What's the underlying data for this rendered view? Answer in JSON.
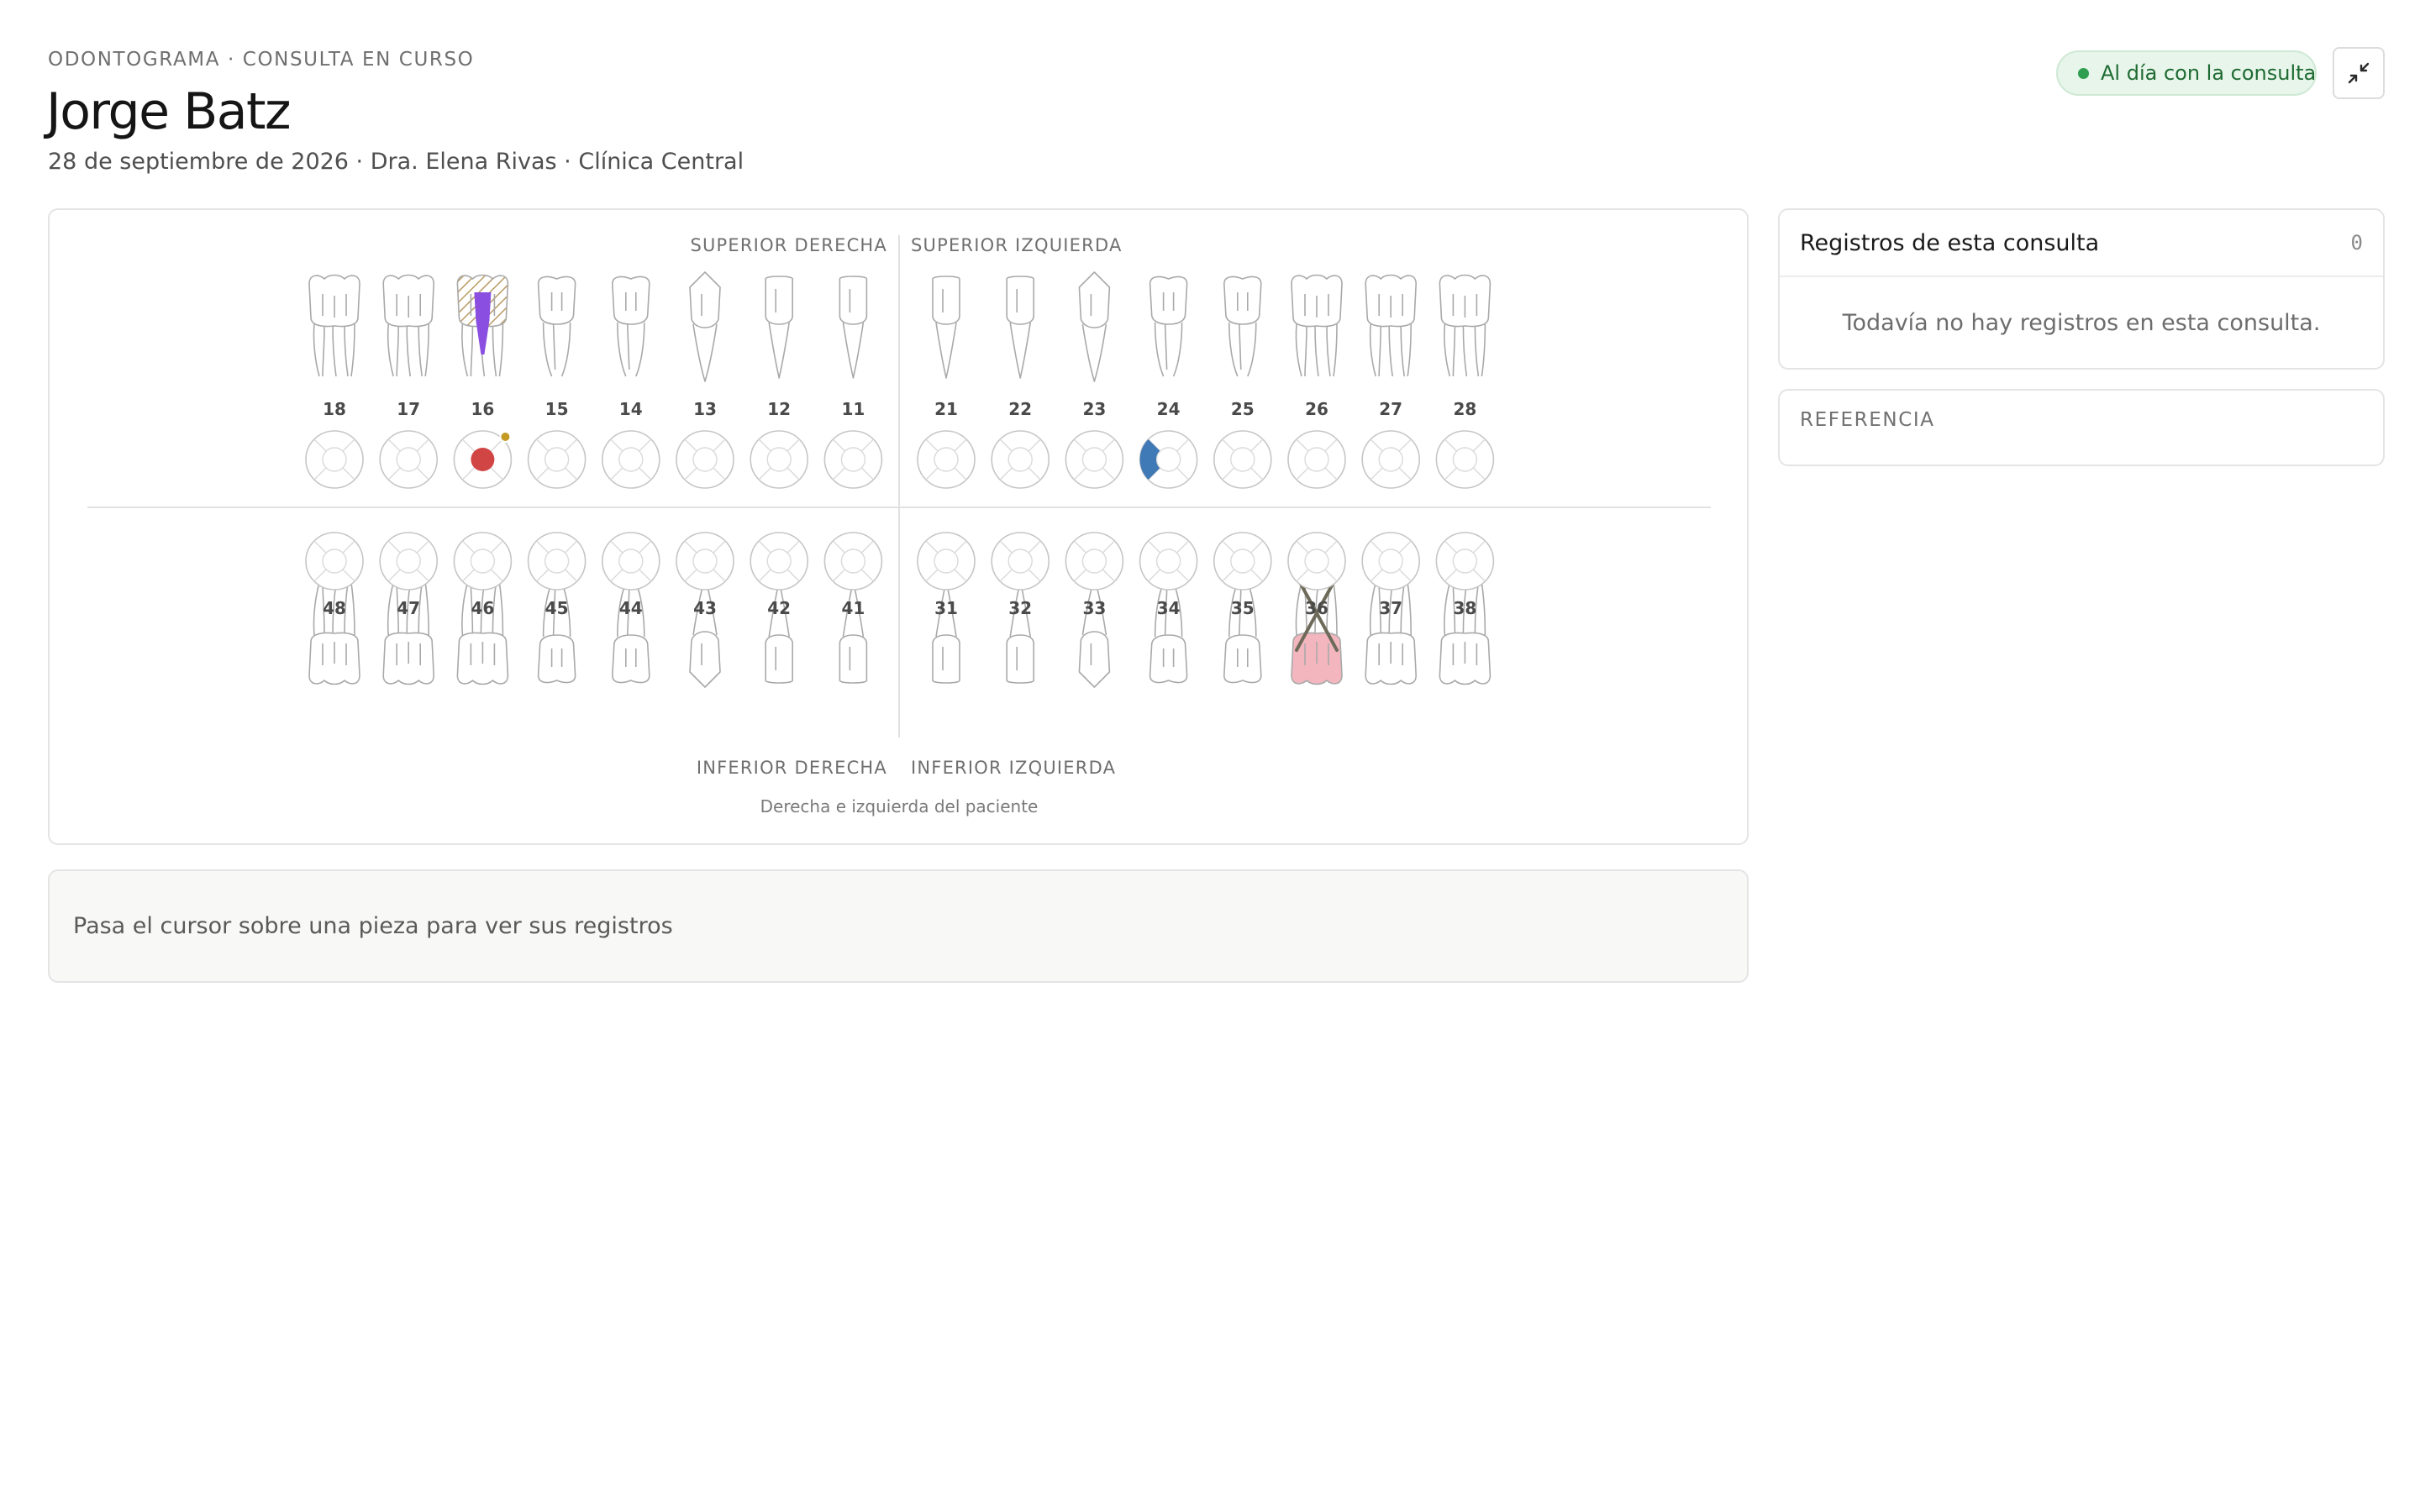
{
  "header": {
    "eyebrow": "ODONTOGRAMA · CONSULTA EN CURSO",
    "patient_name": "Jorge Batz",
    "meta": "28 de septiembre de 2026 · Dra. Elena Rivas · Clínica Central",
    "status": "Al día con la consulta",
    "collapse_icon": "collapse-icon"
  },
  "odontogram": {
    "quadrant_labels": {
      "upper_right": "SUPERIOR DERECHA",
      "upper_left": "SUPERIOR IZQUIERDA",
      "lower_right": "INFERIOR DERECHA",
      "lower_left": "INFERIOR IZQUIERDA"
    },
    "note": "Derecha e izquierda del paciente",
    "upper_teeth": [
      "18",
      "17",
      "16",
      "15",
      "14",
      "13",
      "12",
      "11",
      "21",
      "22",
      "23",
      "24",
      "25",
      "26",
      "27",
      "28"
    ],
    "lower_teeth": [
      "48",
      "47",
      "46",
      "45",
      "44",
      "43",
      "42",
      "41",
      "31",
      "32",
      "33",
      "34",
      "35",
      "36",
      "37",
      "38"
    ],
    "marks": {
      "16": {
        "crown": "hatched",
        "root_canal": true,
        "center_surface": true,
        "indicator_dot": true
      },
      "24": {
        "distal_surface": true
      },
      "36": {
        "extracted": true
      }
    },
    "colors": {
      "caries": "#d14545",
      "restoration": "#3f79b6",
      "endodontic": "#8a4fe0",
      "crown_hatch": "#b99a63",
      "indicator": "#c49a25",
      "extraction": "#6e6a5a",
      "gum": "#f3b6bf",
      "outline": "#a9a9a9"
    }
  },
  "hover_hint": "Pasa el cursor sobre una pieza para ver sus registros",
  "records": {
    "title": "Registros de esta consulta",
    "count": "0",
    "empty": "Todavía no hay registros en esta consulta."
  },
  "reference": {
    "title": "REFERENCIA"
  },
  "theme": {
    "accent_green": "#2f9e4f",
    "pill_bg": "#e7f5ea"
  }
}
